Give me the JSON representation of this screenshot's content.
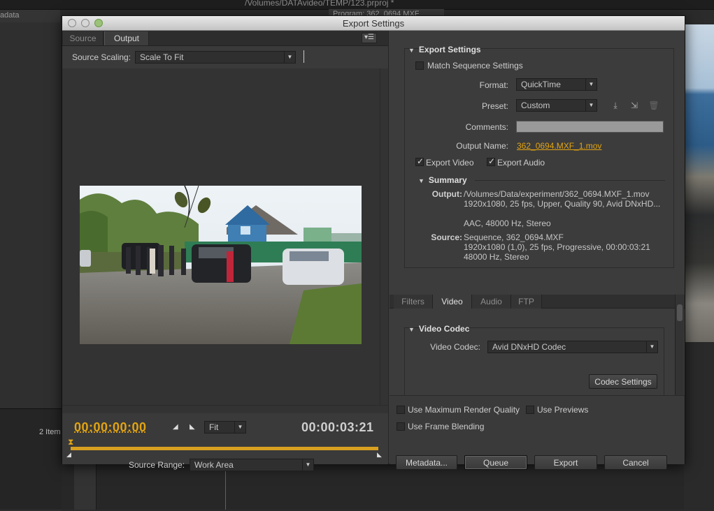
{
  "background": {
    "project_title": "/Volumes/DATAvideo/TEMP/123.prproj *",
    "metadata_tab": "adata",
    "program_tab": "Program: 362_0694.MXF",
    "items_count": "2 Item"
  },
  "dialog": {
    "title": "Export Settings",
    "left": {
      "tabs": [
        "Source",
        "Output"
      ],
      "source_scaling_label": "Source Scaling:",
      "source_scaling_value": "Scale To Fit",
      "timecode_current": "00:00:00:00",
      "timecode_duration": "00:00:03:21",
      "fit_value": "Fit",
      "source_range_label": "Source Range:",
      "source_range_value": "Work Area"
    },
    "export_settings": {
      "heading": "Export Settings",
      "match_sequence_label": "Match Sequence Settings",
      "match_sequence_checked": false,
      "format_label": "Format:",
      "format_value": "QuickTime",
      "preset_label": "Preset:",
      "preset_value": "Custom",
      "comments_label": "Comments:",
      "comments_value": "",
      "output_name_label": "Output Name:",
      "output_name_value": "362_0694.MXF_1.mov",
      "export_video_label": "Export Video",
      "export_video_checked": true,
      "export_audio_label": "Export Audio",
      "export_audio_checked": true,
      "icons": [
        "save-preset-icon",
        "import-preset-icon",
        "delete-preset-icon"
      ]
    },
    "summary": {
      "heading": "Summary",
      "output_label": "Output:",
      "output_lines": [
        "/Volumes/Data/experiment/362_0694.MXF_1.mov",
        "1920x1080, 25 fps, Upper, Quality 90, Avid DNxHD...",
        "",
        "AAC, 48000 Hz, Stereo"
      ],
      "source_label": "Source:",
      "source_lines": [
        "Sequence, 362_0694.MXF",
        "1920x1080 (1,0), 25 fps, Progressive, 00:00:03:21",
        "48000 Hz, Stereo"
      ]
    },
    "settings_tabs": [
      "Filters",
      "Video",
      "Audio",
      "FTP"
    ],
    "active_settings_tab": "Video",
    "video_codec": {
      "heading": "Video Codec",
      "label": "Video Codec:",
      "value": "Avid DNxHD Codec",
      "settings_button": "Codec Settings"
    },
    "options": {
      "max_render_quality": "Use Maximum Render Quality",
      "use_previews": "Use Previews",
      "frame_blending": "Use Frame Blending"
    },
    "buttons": {
      "metadata": "Metadata...",
      "queue": "Queue",
      "export": "Export",
      "cancel": "Cancel"
    }
  },
  "colors": {
    "accent": "#e2a412",
    "dialog_bg": "#3c3c3c"
  }
}
